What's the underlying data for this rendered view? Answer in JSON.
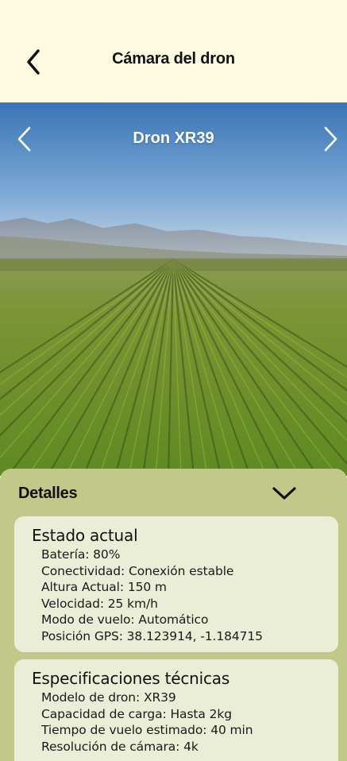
{
  "header": {
    "title": "Cámara del dron",
    "back_icon": "chevron-left-icon"
  },
  "camera": {
    "drone_name": "Dron XR39",
    "prev_icon": "chevron-left-icon",
    "next_icon": "chevron-right-icon"
  },
  "details": {
    "title": "Detalles",
    "toggle_icon": "chevron-down-icon",
    "status": {
      "heading": "Estado actual",
      "items": [
        "Batería: 80%",
        "Conectividad: Conexión estable",
        "Altura Actual: 150 m",
        "Velocidad: 25 km/h",
        "Modo de vuelo: Automático",
        "Posición GPS: 38.123914, -1.184715"
      ]
    },
    "specs": {
      "heading": "Especificaciones técnicas",
      "items": [
        "Modelo de dron: XR39",
        "Capacidad de carga: Hasta 2kg",
        "Tiempo de vuelo estimado: 40 min",
        "Resolución de cámara: 4k"
      ]
    }
  },
  "colors": {
    "header_bg": "#fdfae2",
    "panel_bg": "#c2c88a",
    "card_bg": "#ebeed6",
    "sky_top": "#3f78b8",
    "field_green": "#6f8f2c"
  }
}
